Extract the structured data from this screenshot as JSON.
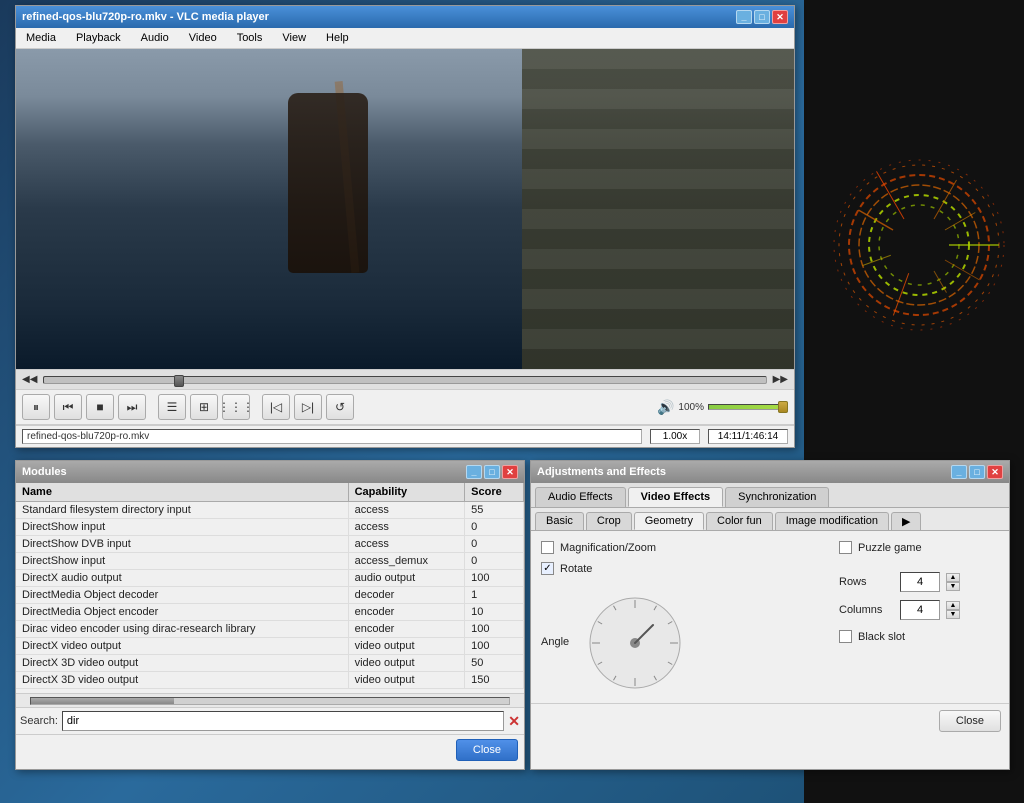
{
  "desktop": {
    "bg_color": "#2a5a8c"
  },
  "vlc_main": {
    "title": "refined-qos-blu720p-ro.mkv - VLC media player",
    "menu": {
      "items": [
        "Media",
        "Playback",
        "Audio",
        "Video",
        "Tools",
        "View",
        "Help"
      ]
    },
    "statusbar": {
      "filename": "refined-qos-blu720p-ro.mkv",
      "speed": "1.00x",
      "time": "14:11/1:46:14"
    },
    "controls": {
      "play_pause": "⏸",
      "prev": "⏮",
      "stop": "■",
      "next": "⏭",
      "frame_prev": "◁",
      "frame_next": "▷",
      "fullscreen": "⛶",
      "playlist": "☰",
      "extended": "⊞"
    },
    "volume": {
      "pct": "100%",
      "icon": "🔊"
    }
  },
  "modules_window": {
    "title": "Modules",
    "columns": [
      "Name",
      "Capability",
      "Score"
    ],
    "rows": [
      {
        "name": "Standard filesystem directory input",
        "capability": "access",
        "score": "55"
      },
      {
        "name": "DirectShow input",
        "capability": "access",
        "score": "0"
      },
      {
        "name": "DirectShow DVB input",
        "capability": "access",
        "score": "0"
      },
      {
        "name": "DirectShow input",
        "capability": "access_demux",
        "score": "0"
      },
      {
        "name": "DirectX audio output",
        "capability": "audio output",
        "score": "100"
      },
      {
        "name": "DirectMedia Object decoder",
        "capability": "decoder",
        "score": "1"
      },
      {
        "name": "DirectMedia Object encoder",
        "capability": "encoder",
        "score": "10"
      },
      {
        "name": "Dirac video encoder using dirac-research library",
        "capability": "encoder",
        "score": "100"
      },
      {
        "name": "DirectX video output",
        "capability": "video output",
        "score": "100"
      },
      {
        "name": "DirectX 3D video output",
        "capability": "video output",
        "score": "50"
      },
      {
        "name": "DirectX 3D video output",
        "capability": "video output",
        "score": "150"
      }
    ],
    "search": {
      "label": "Search:",
      "value": "dir"
    },
    "close_label": "Close"
  },
  "effects_window": {
    "title": "Adjustments and Effects",
    "main_tabs": [
      "Audio Effects",
      "Video Effects",
      "Synchronization"
    ],
    "active_main_tab": "Video Effects",
    "sub_tabs": [
      "Basic",
      "Crop",
      "Geometry",
      "Color fun",
      "Image modification"
    ],
    "active_sub_tab": "Geometry",
    "geometry": {
      "magnification_zoom": {
        "label": "Magnification/Zoom",
        "checked": false
      },
      "rotate": {
        "label": "Rotate",
        "checked": true
      },
      "angle_label": "Angle",
      "puzzle_game": {
        "label": "Puzzle game",
        "checked": false
      },
      "rows": {
        "label": "Rows",
        "value": "4"
      },
      "columns": {
        "label": "Columns",
        "value": "4"
      },
      "black_slot": {
        "label": "Black slot",
        "checked": false
      }
    },
    "close_label": "Close"
  }
}
